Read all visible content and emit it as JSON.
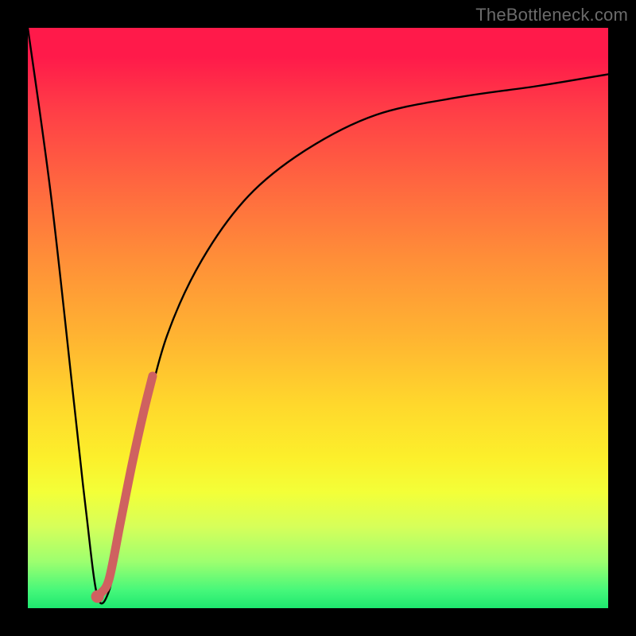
{
  "watermark": {
    "text": "TheBottleneck.com"
  },
  "gradient": {
    "stops": [
      {
        "pct": 0,
        "color": "#ff1a4a"
      },
      {
        "pct": 5,
        "color": "#ff1a4a"
      },
      {
        "pct": 14,
        "color": "#ff3d47"
      },
      {
        "pct": 28,
        "color": "#ff6a3f"
      },
      {
        "pct": 40,
        "color": "#ff8f38"
      },
      {
        "pct": 54,
        "color": "#ffb631"
      },
      {
        "pct": 65,
        "color": "#ffd82c"
      },
      {
        "pct": 74,
        "color": "#fcef2b"
      },
      {
        "pct": 80,
        "color": "#f3ff38"
      },
      {
        "pct": 86,
        "color": "#d6ff5a"
      },
      {
        "pct": 92,
        "color": "#9dff6f"
      },
      {
        "pct": 97,
        "color": "#45f77a"
      },
      {
        "pct": 100,
        "color": "#1ee86f"
      }
    ]
  },
  "chart_data": {
    "type": "line",
    "title": "",
    "xlabel": "",
    "ylabel": "",
    "xlim": [
      0,
      100
    ],
    "ylim": [
      0,
      100
    ],
    "comment": "y ≈ bottleneck percentage; x ≈ relative component balance. Curve dips to ~0 near x≈12 (optimal), rises steeply on the left edge and asymptotically toward ~92 on the right.",
    "series": [
      {
        "name": "bottleneck-curve",
        "color": "#000000",
        "x": [
          0,
          4,
          8,
          10,
          12,
          14,
          16,
          18,
          20,
          24,
          30,
          38,
          48,
          60,
          74,
          88,
          100
        ],
        "y": [
          100,
          71,
          35,
          17,
          2,
          3,
          13,
          23,
          32,
          47,
          60,
          71,
          79,
          85,
          88,
          90,
          92
        ]
      },
      {
        "name": "highlight-segment",
        "color": "#cf6160",
        "thick": true,
        "x": [
          12.5,
          14,
          16,
          18,
          20,
          21.5
        ],
        "y": [
          2.5,
          5,
          15,
          25,
          34,
          40
        ]
      },
      {
        "name": "highlight-dot",
        "color": "#cf6160",
        "type": "scatter",
        "x": [
          12
        ],
        "y": [
          2
        ]
      }
    ]
  }
}
